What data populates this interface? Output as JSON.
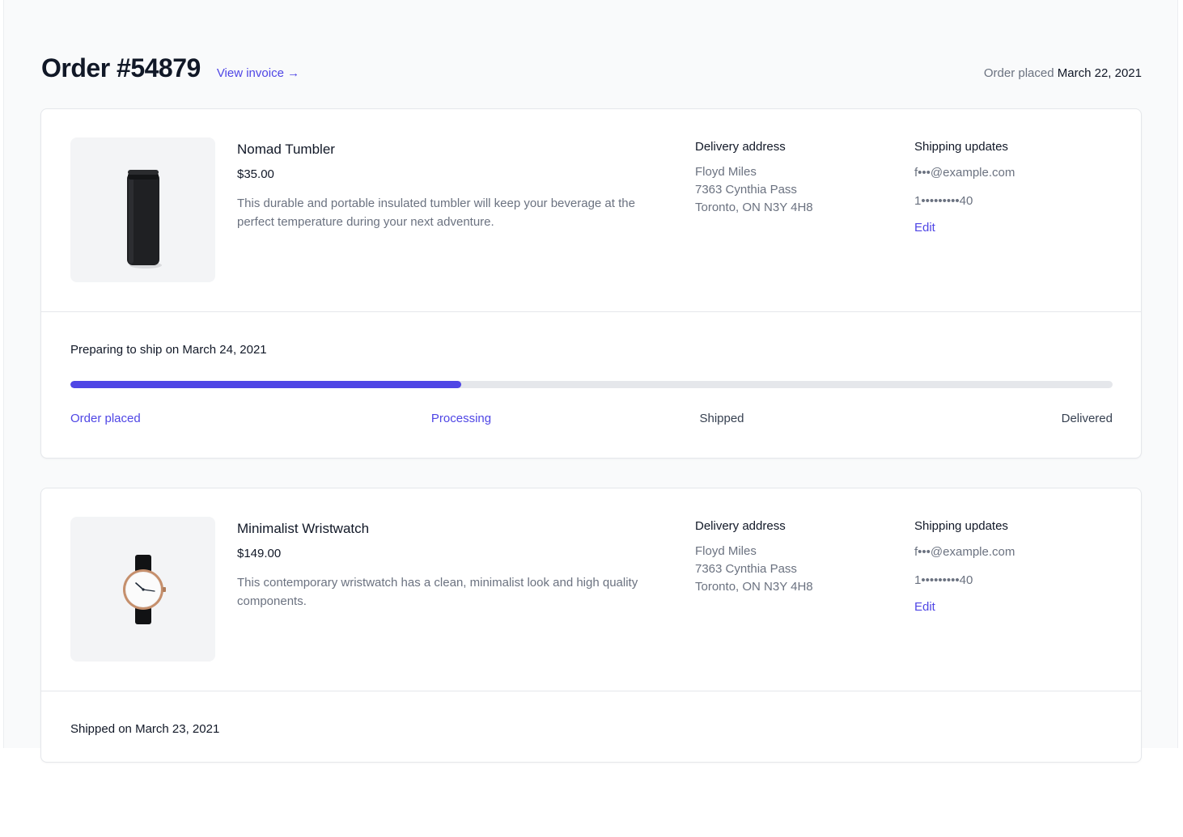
{
  "order": {
    "title": "Order #54879",
    "invoice_link": "View invoice →",
    "placed_label": "Order placed",
    "placed_date": "March 22, 2021"
  },
  "items": [
    {
      "name": "Nomad Tumbler",
      "price": "$35.00",
      "description": "This durable and portable insulated tumbler will keep your beverage at the perfect temperature during your next adventure.",
      "image_icon": "tumbler-image",
      "delivery_heading": "Delivery address",
      "address": [
        "Floyd Miles",
        "7363 Cynthia Pass",
        "Toronto, ON N3Y 4H8"
      ],
      "shipping_heading": "Shipping updates",
      "email": "f•••@example.com",
      "phone": "1•••••••••40",
      "edit_label": "Edit",
      "status": "Preparing to ship on March 24, 2021",
      "progress": 0.375,
      "steps": [
        "Order placed",
        "Processing",
        "Shipped",
        "Delivered"
      ],
      "completed_steps": 2
    },
    {
      "name": "Minimalist Wristwatch",
      "price": "$149.00",
      "description": "This contemporary wristwatch has a clean, minimalist look and high quality components.",
      "image_icon": "wristwatch-image",
      "delivery_heading": "Delivery address",
      "address": [
        "Floyd Miles",
        "7363 Cynthia Pass",
        "Toronto, ON N3Y 4H8"
      ],
      "shipping_heading": "Shipping updates",
      "email": "f•••@example.com",
      "phone": "1•••••••••40",
      "edit_label": "Edit",
      "status": "Shipped on March 23, 2021"
    }
  ],
  "colors": {
    "accent": "#4f46e5",
    "track": "#e5e7eb",
    "muted_text": "#6b7280"
  }
}
